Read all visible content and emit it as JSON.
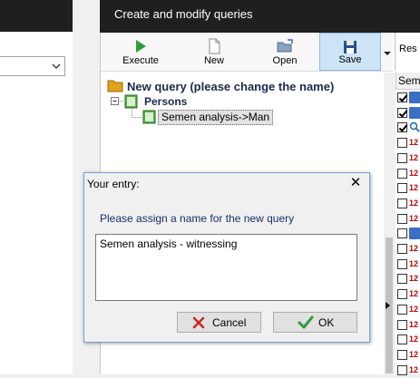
{
  "main_window": {
    "title": "Create and modify queries"
  },
  "toolbar": {
    "execute_label": "Execute",
    "new_label": "New",
    "open_label": "Open",
    "save_label": "Save",
    "next_label_partial": "Res"
  },
  "tree": {
    "root_label": "New query (please change the name)",
    "persons_label": "Persons",
    "leaf_label": "Semen analysis->Man"
  },
  "grid": {
    "header_partial": "Sem",
    "rows": [
      {
        "checked": true,
        "icon": "blue-field-icon"
      },
      {
        "checked": true,
        "icon": "blue-field-icon"
      },
      {
        "checked": true,
        "icon": "magnifier-field-icon"
      },
      {
        "checked": false,
        "icon": "numeric-field-icon"
      },
      {
        "checked": false,
        "icon": "numeric-field-icon"
      },
      {
        "checked": false,
        "icon": "numeric-field-icon"
      },
      {
        "checked": false,
        "icon": "numeric-field-icon"
      },
      {
        "checked": false,
        "icon": "numeric-field-icon"
      },
      {
        "checked": false,
        "icon": "numeric-field-icon"
      },
      {
        "checked": false,
        "icon": "blue-field-icon"
      },
      {
        "checked": false,
        "icon": "numeric-field-icon"
      },
      {
        "checked": false,
        "icon": "numeric-field-icon"
      },
      {
        "checked": false,
        "icon": "numeric-field-icon"
      },
      {
        "checked": false,
        "icon": "numeric-field-icon"
      },
      {
        "checked": false,
        "icon": "numeric-field-icon"
      },
      {
        "checked": false,
        "icon": "numeric-field-icon"
      },
      {
        "checked": false,
        "icon": "numeric-field-icon"
      },
      {
        "checked": false,
        "icon": "numeric-field-icon"
      },
      {
        "checked": false,
        "icon": "numeric-field-icon"
      }
    ],
    "numeric_glyph": "12"
  },
  "dialog": {
    "title": "Your entry:",
    "prompt": "Please assign a name for the new query",
    "input_value": "Semen analysis - witnessing",
    "cancel_label": "Cancel",
    "ok_label": "OK"
  },
  "colors": {
    "titlebar": "#1f1f1f",
    "accent_green": "#2e9d3a",
    "cancel_red": "#c62828",
    "save_highlight": "#cde4f7"
  }
}
